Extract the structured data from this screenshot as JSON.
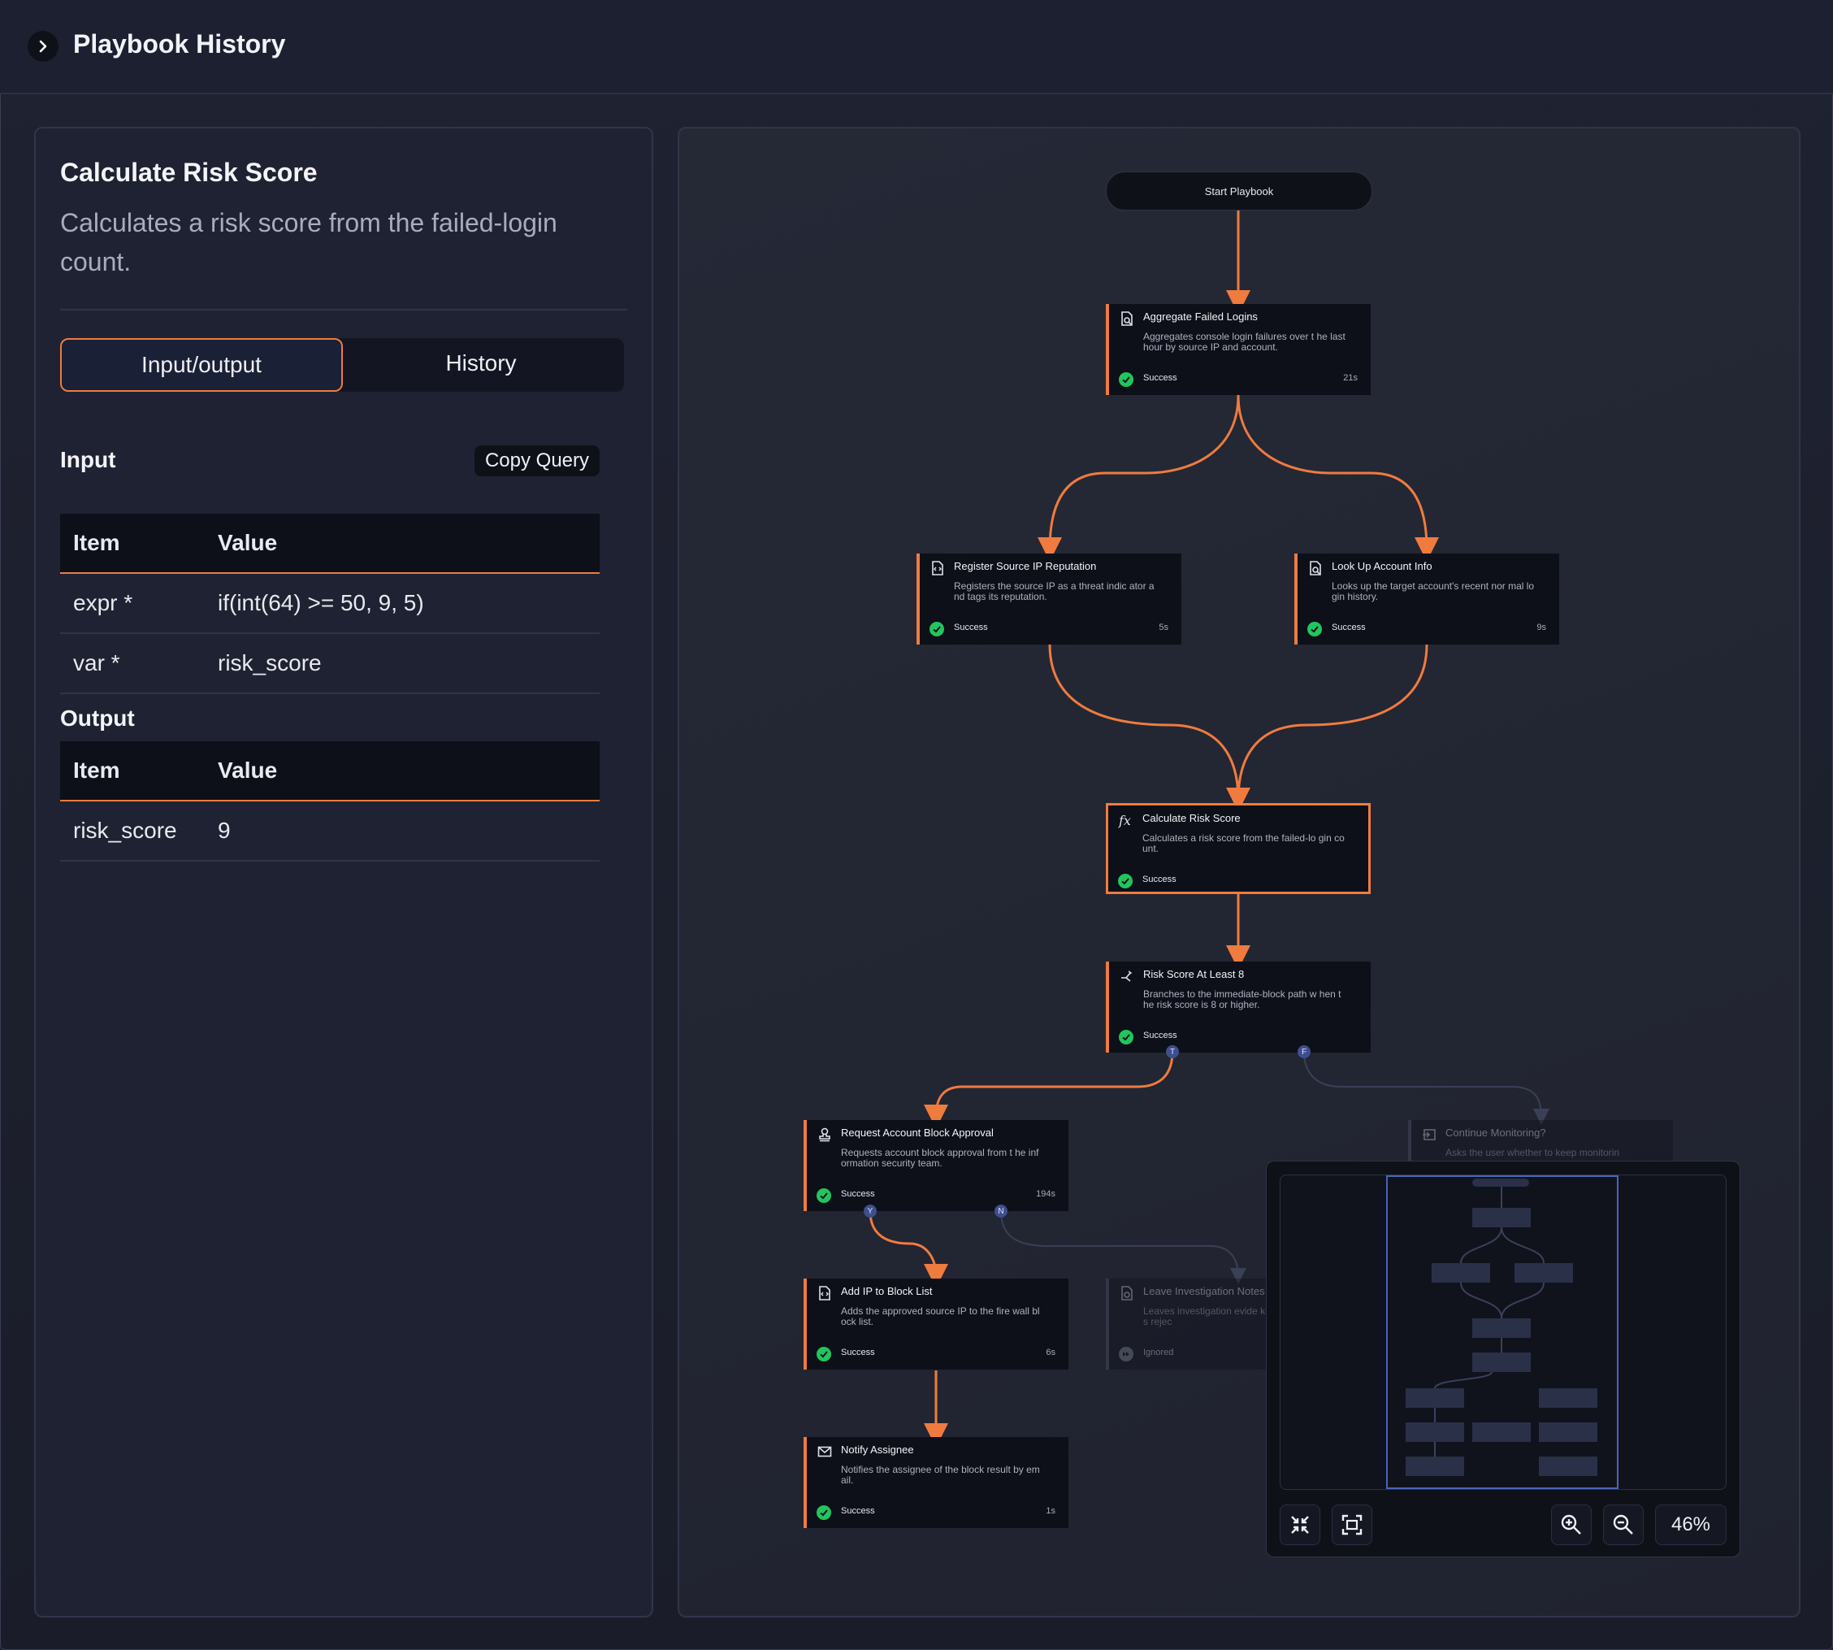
{
  "header": {
    "title": "Playbook History"
  },
  "detail": {
    "title": "Calculate Risk Score",
    "description": "Calculates a risk score from the failed-login count.",
    "tabs": [
      {
        "label": "Input/output",
        "active": true
      },
      {
        "label": "History",
        "active": false
      }
    ],
    "input": {
      "title": "Input",
      "copy_label": "Copy Query",
      "headers": [
        "Item",
        "Value"
      ],
      "rows": [
        {
          "item": "expr *",
          "value": "if(int(64) >= 50, 9, 5)"
        },
        {
          "item": "var *",
          "value": "risk_score"
        }
      ]
    },
    "output": {
      "title": "Output",
      "headers": [
        "Item",
        "Value"
      ],
      "rows": [
        {
          "item": "risk_score",
          "value": "9"
        }
      ]
    }
  },
  "flow": {
    "start_label": "Start Playbook",
    "nodes": {
      "aggregate": {
        "title": "Aggregate Failed Logins",
        "desc": "Aggregates console login failures over t he last hour by source IP and account.",
        "status": "Success",
        "time": "21s"
      },
      "register_ip": {
        "title": "Register Source IP Reputation",
        "desc": "Registers the source IP as a threat indic ator and tags its reputation.",
        "status": "Success",
        "time": "5s"
      },
      "lookup_account": {
        "title": "Look Up Account Info",
        "desc": "Looks up the target account's recent nor mal login history.",
        "status": "Success",
        "time": "9s"
      },
      "calc_risk": {
        "title": "Calculate Risk Score",
        "desc": "Calculates a risk score from the failed-lo gin count.",
        "status": "Success",
        "time": ""
      },
      "risk_branch": {
        "title": "Risk Score At Least 8",
        "desc": "Branches to the immediate-block path w hen the risk score is 8 or higher.",
        "status": "Success",
        "time": ""
      },
      "request_approval": {
        "title": "Request Account Block Approval",
        "desc": "Requests account block approval from t he information security team.",
        "status": "Success",
        "time": "194s"
      },
      "continue_monitoring": {
        "title": "Continue Monitoring?",
        "desc": "Asks the user whether to keep monitorin",
        "status": "",
        "time": ""
      },
      "add_block": {
        "title": "Add IP to Block List",
        "desc": "Adds the approved source IP to the fire wall block list.",
        "status": "Success",
        "time": "6s"
      },
      "leave_notes": {
        "title": "Leave Investigation Notes",
        "desc": "Leaves investigation evide ket when approval is rejec",
        "status": "Ignored",
        "time": ""
      },
      "notify": {
        "title": "Notify Assignee",
        "desc": "Notifies the assignee of the block result by email.",
        "status": "Success",
        "time": "1s"
      }
    },
    "ports": {
      "true": "T",
      "false": "F",
      "yes": "Y",
      "no": "N"
    },
    "accent_color": "#f07b3f"
  },
  "minimap": {
    "zoom": "46%"
  }
}
